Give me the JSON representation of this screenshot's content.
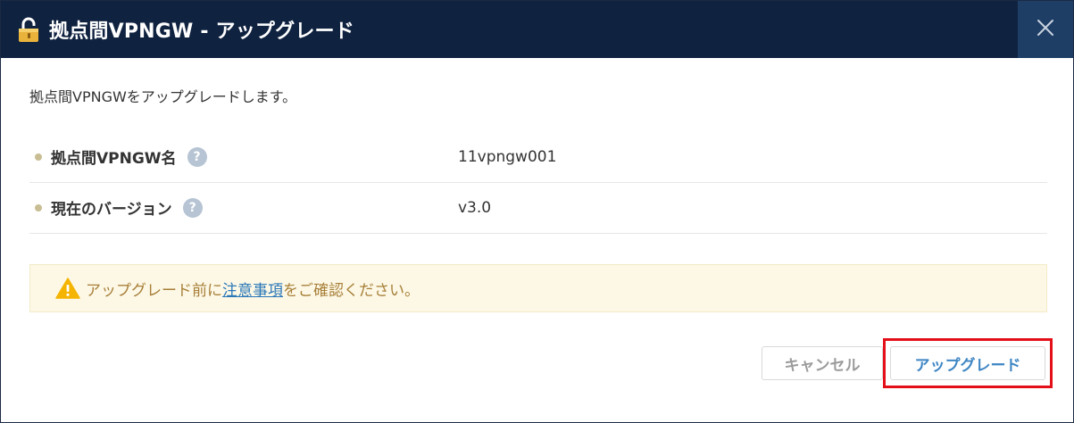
{
  "dialog": {
    "title": "拠点間VPNGW - アップグレード",
    "title_icon": "lock-icon",
    "close_icon": "close-icon",
    "description": "拠点間VPNGWをアップグレードします。"
  },
  "fields": [
    {
      "label": "拠点間VPNGW名",
      "help": "?",
      "value": "11vpngw001"
    },
    {
      "label": "現在のバージョン",
      "help": "?",
      "value": "v3.0"
    }
  ],
  "warning": {
    "icon": "warning-icon",
    "text_before": "アップグレード前に",
    "link_text": "注意事項",
    "text_after": "をご確認ください。"
  },
  "buttons": {
    "cancel_label": "キャンセル",
    "upgrade_label": "アップグレード"
  },
  "colors": {
    "titlebar": "#0f2240",
    "close_button": "#1e3e66",
    "accent": "#3f86c4",
    "warning_text": "#a77f38",
    "highlight": "#e3101a"
  }
}
